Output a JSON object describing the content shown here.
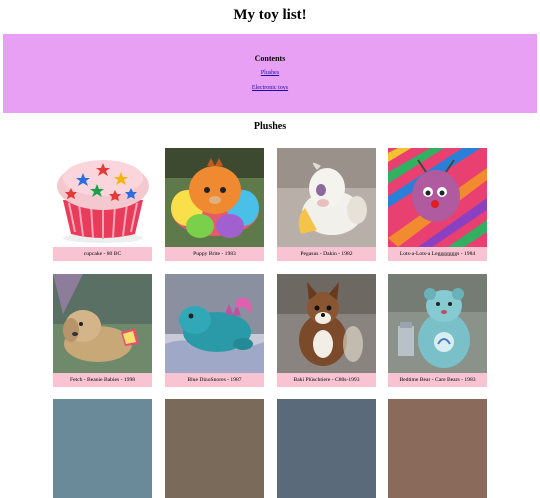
{
  "page": {
    "title": "My toy list!"
  },
  "contents": {
    "heading": "Contents",
    "links": [
      "Plushes",
      "Electronic toys"
    ]
  },
  "section": {
    "title": "Plushes"
  },
  "items": [
    {
      "caption": "cupcake - 80 BC",
      "image_subject": "cupcake-with-star-sprinkles"
    },
    {
      "caption": "Puppy Brite - 1983",
      "image_subject": "orange-shaggy-plush-rainbow-costume"
    },
    {
      "caption": "Pegasus - Dakin - 1982",
      "image_subject": "white-pegasus-plush"
    },
    {
      "caption": "Lots-a-Lots-a Legggggggs - 1984",
      "image_subject": "purple-caterpillar-plush-striped-blanket"
    },
    {
      "caption": "Fetch - Beanie Babies - 1998",
      "image_subject": "tan-dog-beanie-baby"
    },
    {
      "caption": "Blue DinoSnores - 1987",
      "image_subject": "blue-dinosaur-plush"
    },
    {
      "caption": "Baki Plüschtiere - C80s-1993",
      "image_subject": "brown-fox-plush"
    },
    {
      "caption": "Bedtime Bear - Care Bears - 1983",
      "image_subject": "teal-bear-plush"
    }
  ]
}
